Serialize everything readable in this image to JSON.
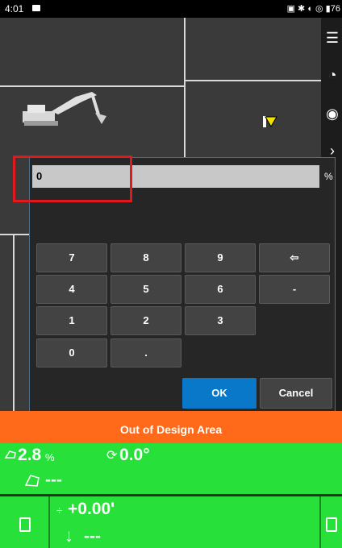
{
  "status_bar": {
    "time": "4:01",
    "battery": "76"
  },
  "dialog": {
    "input_value": "0",
    "unit": "%",
    "keys": [
      "7",
      "8",
      "9",
      "⇦",
      "4",
      "5",
      "6",
      "-",
      "1",
      "2",
      "3",
      "0",
      "."
    ],
    "ok_label": "OK",
    "cancel_label": "Cancel"
  },
  "banner": {
    "text": "Out of Design Area"
  },
  "readouts": {
    "slope_value": "2.8",
    "slope_unit": "%",
    "rotation_value": "0.0°",
    "second_row_value": "---",
    "elevation_value": "+0.00'",
    "cut_fill_value": "---"
  },
  "colors": {
    "accent_blue": "#0a78c8",
    "banner_orange": "#ff6a1a",
    "status_green": "#28e03a",
    "highlight_red": "#e0191e"
  },
  "icons": [
    "hamburger-menu-icon",
    "camera-rotate-icon",
    "lock-rotate-icon",
    "chevron-icon",
    "excavator-icon",
    "bucket-marker-icon",
    "rotation-icon",
    "tilt-icon",
    "level-icon",
    "down-arrow-icon"
  ]
}
